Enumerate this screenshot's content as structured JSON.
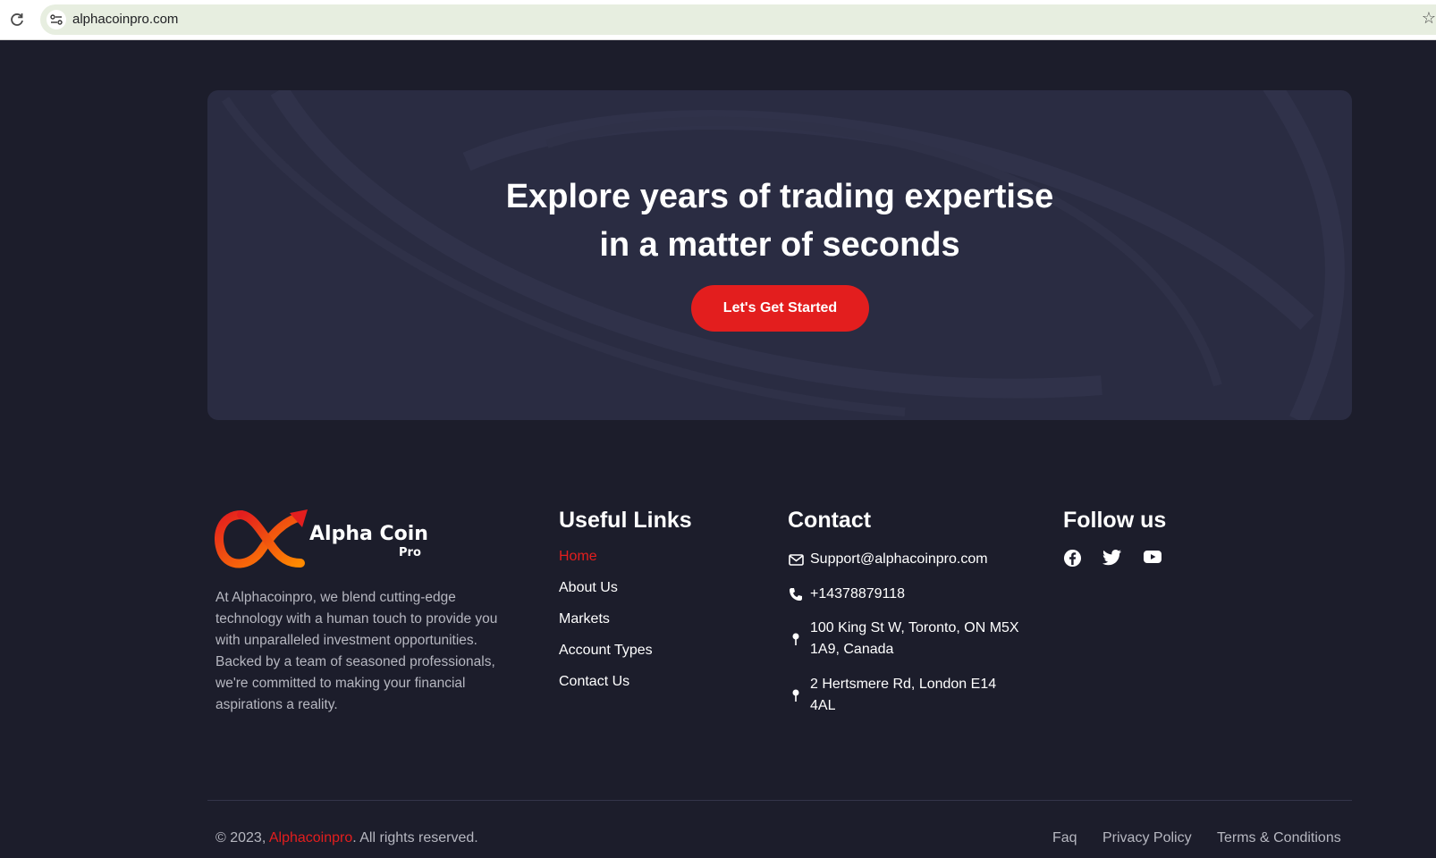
{
  "browser": {
    "url": "alphacoinpro.com"
  },
  "hero": {
    "title_line1": "Explore years of trading expertise",
    "title_line2": "in a matter of seconds",
    "cta_label": "Let's Get Started"
  },
  "brand": {
    "logo_line1": "Alpha Coin",
    "logo_line2": "Pro",
    "about": "At Alphacoinpro, we blend cutting-edge technology with a human touch to provide you with unparalleled investment opportunities. Backed by a team of seasoned professionals, we're committed to making your financial aspirations a reality."
  },
  "useful_links": {
    "title": "Useful Links",
    "items": [
      "Home",
      "About Us",
      "Markets",
      "Account Types",
      "Contact Us"
    ]
  },
  "contact": {
    "title": "Contact",
    "email": "Support@alphacoinpro.com",
    "phone": "+14378879118",
    "address1": "100 King St W, Toronto, ON M5X 1A9, Canada",
    "address2": "2 Hertsmere Rd, London E14 4AL"
  },
  "follow": {
    "title": "Follow us",
    "icons": [
      "facebook-icon",
      "twitter-icon",
      "youtube-icon"
    ]
  },
  "footer": {
    "copyright_prefix": "© 2023, ",
    "copyright_brand": "Alphacoinpro",
    "copyright_suffix": ". All rights reserved.",
    "faq": "Faq",
    "privacy": "Privacy Policy",
    "terms": "Terms & Conditions"
  },
  "colors": {
    "page_bg": "#1c1d2b",
    "hero_bg": "#2a2c42",
    "accent": "#e31e1e",
    "muted_text": "#b6b7c0"
  }
}
